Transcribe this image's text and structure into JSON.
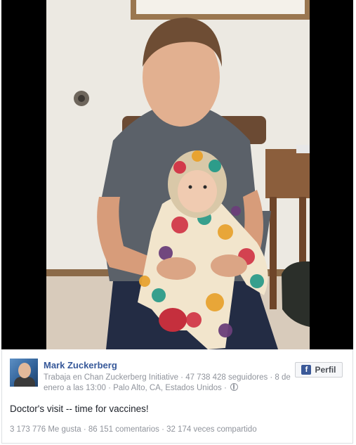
{
  "post": {
    "author": "Mark Zuckerberg",
    "meta_prefix": "Trabaja en Chan Zuckerberg Initiative · 47 738 428 seguidores · 8",
    "meta_date_location": "de enero a las 13:00 · Palo Alto, CA, Estados Unidos ·",
    "profile_button_label": "Perfil",
    "text": "Doctor's visit -- time for vaccines!",
    "stats": "3 173 776 Me gusta · 86 151 comentarios · 32 174 veces compartido"
  },
  "icons": {
    "profile_button": "facebook-icon",
    "privacy": "globe-icon"
  },
  "colors": {
    "author_link": "#365899",
    "meta_text": "#90949c",
    "facebook_blue": "#3b5998"
  }
}
